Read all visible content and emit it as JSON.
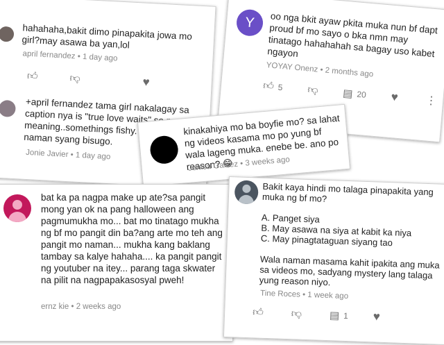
{
  "comments": [
    {
      "text": "hahahaha,bakit dimo pinapakita jowa mo girl?may asawa ba yan,lol",
      "author": "april fernandez",
      "time": "1 day ago",
      "avatar_color": "#6f6460"
    },
    {
      "text": "+april fernandez tama girl nakalagay sa caption nya is \"true love waits\" so may meaning..somethings fishy. well muka naman syang bisugo.",
      "author": "Jonie Javier",
      "time": "1 day ago",
      "avatar_color": "#8a7d86"
    },
    {
      "text": "oo nga bkit ayaw pkita muka nun bf dapt proud bf mo sayo o bka nmn may tinatago hahahahah sa bagay uso kabet ngayon",
      "author": "YOYAY Onenz",
      "time": "2 months ago",
      "avatar_letter": "Y",
      "avatar_color": "#6a4fc7",
      "like_count": "5",
      "reply_count": "20"
    },
    {
      "text": "kinakahiya mo ba boyfie mo? sa lahat ng videos kasama mo po yung bf wala lageng muka. enebe be. ano po reason? 😁",
      "author": "Jenica Galvez",
      "time": "3 weeks ago",
      "avatar_color": "#000000"
    },
    {
      "text": "bat ka pa nagpa make up ate?sa pangit mong yan ok na pang halloween ang pagmumukha mo... bat mo tinatago mukha ng bf mo pangit din ba?ang arte mo teh ang pangit mo naman... mukha kang baklang tambay sa kalye hahaha.... ka pangit pangit ng youtuber na itey... parang taga skwater na pilit na nagpapakasosyal pweh!",
      "author": "ernz kie",
      "time": "2 weeks ago",
      "avatar_color": "#c2185b"
    },
    {
      "text": "Bakit kaya hindi mo talaga pinapakita yang muka ng bf mo?\n\nA. Panget siya\nB. May asawa na siya at kabit ka niya\nC. May pinagtataguan siyang tao\n\nWala naman masama kahit ipakita ang muka sa videos mo, sadyang mystery lang talaga yung reason niyo.",
      "author": "Tine Roces",
      "time": "1 week ago",
      "avatar_color": "#4b5560",
      "reply_count": "1"
    }
  ],
  "separator": "•"
}
